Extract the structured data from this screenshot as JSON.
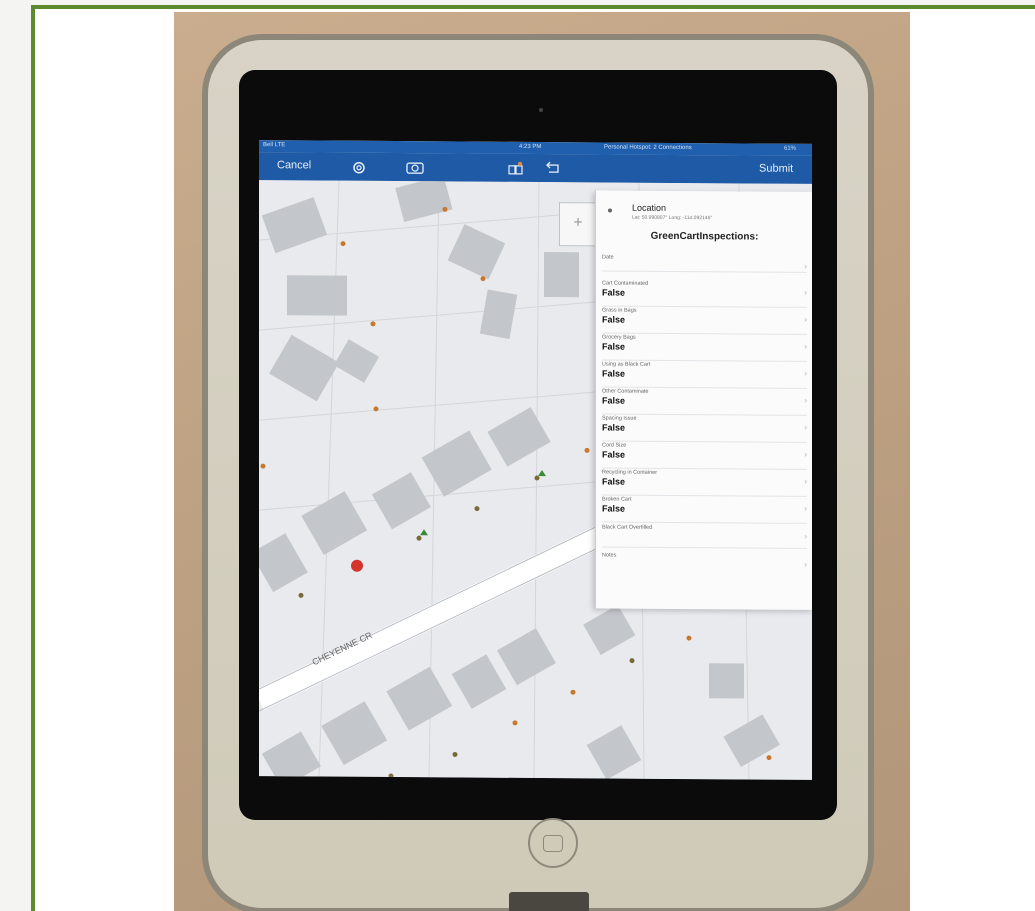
{
  "status_bar": {
    "carrier": "Bell LTE",
    "time": "4:23 PM",
    "network": "Personal Hotspot: 2 Connections",
    "battery": "61%"
  },
  "nav": {
    "cancel": "Cancel",
    "submit": "Submit"
  },
  "icons": [
    "gear-icon",
    "camera-icon",
    "layers-icon",
    "undo-icon"
  ],
  "map": {
    "street_label": "CHEYENNE CR",
    "zoom_plus": "+"
  },
  "panel": {
    "location_title": "Location",
    "location_coords": "Lat: 50.990807° Long: -114.092146°",
    "form_title": "GreenCartInspections:",
    "fields": [
      {
        "label": "Date",
        "value": ""
      },
      {
        "label": "Cart Contaminated",
        "value": "False"
      },
      {
        "label": "Grass in Bags",
        "value": "False"
      },
      {
        "label": "Grocery Bags",
        "value": "False"
      },
      {
        "label": "Using as Black Cart",
        "value": "False"
      },
      {
        "label": "Other Contaminate",
        "value": "False"
      },
      {
        "label": "Spacing Issue",
        "value": "False"
      },
      {
        "label": "Cord Size",
        "value": "False"
      },
      {
        "label": "Recycling in Container",
        "value": "False"
      },
      {
        "label": "Broken Cart",
        "value": "False"
      },
      {
        "label": "Black Cart Overfilled",
        "value": ""
      },
      {
        "label": "Notes",
        "value": ""
      }
    ]
  },
  "colors": {
    "frame_border": "#5b8a2f",
    "navbar": "#1e5aa5",
    "selected_point": "#d4342a",
    "point": "#c8782e",
    "ok_point": "#3a8a3a"
  }
}
